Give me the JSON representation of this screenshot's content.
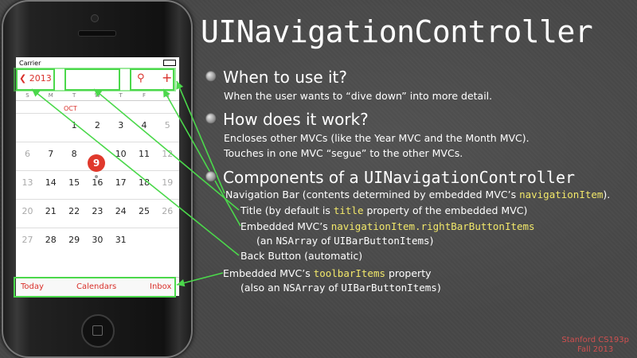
{
  "slide": {
    "title": "UINavigationController",
    "bullets": [
      {
        "heading": "When to use it?",
        "lines": [
          "When the user wants to “dive down” into more detail."
        ]
      },
      {
        "heading": "How does it work?",
        "lines": [
          "Encloses other MVCs (like the Year MVC and the Month MVC).",
          "Touches in one MVC “segue” to the other MVCs."
        ]
      },
      {
        "heading_prefix": "Components of a ",
        "heading_code": "UINavigationController"
      }
    ],
    "components": {
      "nav_bar_prefix": "Navigation Bar (contents determined by embedded MVC’s ",
      "nav_bar_code": "navigationItem",
      "nav_bar_suffix": ").",
      "title_prefix": "Title (by default is ",
      "title_code": "title",
      "title_suffix": " property of the embedded MVC)",
      "right_prefix": "Embedded MVC’s ",
      "right_code": "navigationItem.rightBarButtonItems",
      "right_note_prefix": "(an ",
      "right_note_code": "NSArray",
      "right_note_mid": " of ",
      "right_note_code2": "UIBarButtonItems",
      "right_note_suffix": ")",
      "back": "Back Button (automatic)",
      "toolbar_prefix": "Embedded MVC’s ",
      "toolbar_code": "toolbarItems",
      "toolbar_suffix": " property",
      "toolbar_note_prefix": "(also an ",
      "toolbar_note_code": "NSArray",
      "toolbar_note_mid": " of ",
      "toolbar_note_code2": "UIBarButtonItems",
      "toolbar_note_suffix": ")"
    },
    "credit": [
      "Stanford CS193p",
      "Fall 2013"
    ]
  },
  "phone": {
    "carrier": "Carrier",
    "back_label": "2013",
    "weekdays": [
      "S",
      "M",
      "T",
      "W",
      "T",
      "F",
      "S"
    ],
    "month_label": "OCT",
    "weeks": [
      [
        "",
        "",
        "1",
        "2",
        "3",
        "4",
        "5"
      ],
      [
        "6",
        "7",
        "8",
        "9",
        "10",
        "11",
        "12"
      ],
      [
        "13",
        "14",
        "15",
        "16",
        "17",
        "18",
        "19"
      ],
      [
        "20",
        "21",
        "22",
        "23",
        "24",
        "25",
        "26"
      ],
      [
        "27",
        "28",
        "29",
        "30",
        "31",
        "",
        ""
      ]
    ],
    "toolbar": {
      "today": "Today",
      "calendars": "Calendars",
      "inbox": "Inbox"
    }
  },
  "colors": {
    "accent": "#d9302a",
    "highlight": "#4bd84b",
    "code": "#f2e86a"
  },
  "icons": [
    "back-chevron-icon",
    "search-icon",
    "add-icon",
    "bullet-icon"
  ]
}
